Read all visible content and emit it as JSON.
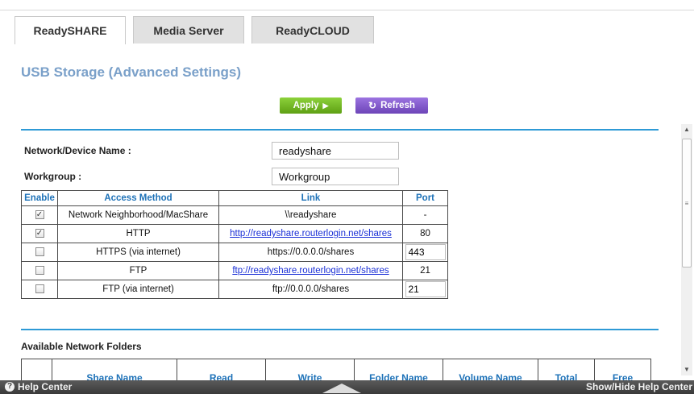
{
  "tabs": [
    {
      "label": "ReadySHARE",
      "active": true
    },
    {
      "label": "Media Server",
      "active": false
    },
    {
      "label": "ReadyCLOUD",
      "active": false
    }
  ],
  "page_title": "USB Storage (Advanced Settings)",
  "buttons": {
    "apply_label": "Apply",
    "apply_icon": "play-arrow-icon",
    "refresh_label": "Refresh",
    "refresh_icon": "refresh-icon"
  },
  "device": {
    "network_device_name_label": "Network/Device Name :",
    "network_device_name_value": "readyshare",
    "workgroup_label": "Workgroup :",
    "workgroup_value": "Workgroup"
  },
  "access_table": {
    "headers": [
      "Enable",
      "Access Method",
      "Link",
      "Port"
    ],
    "rows": [
      {
        "enabled": true,
        "method": "Network Neighborhood/MacShare",
        "link": "\\\\readyshare",
        "link_is_url": false,
        "port": "-",
        "port_editable": false
      },
      {
        "enabled": true,
        "method": "HTTP",
        "link": "http://readyshare.routerlogin.net/shares",
        "link_is_url": true,
        "port": "80",
        "port_editable": false
      },
      {
        "enabled": false,
        "method": "HTTPS (via internet)",
        "link": "https://0.0.0.0/shares",
        "link_is_url": false,
        "port": "443",
        "port_editable": true
      },
      {
        "enabled": false,
        "method": "FTP",
        "link": "ftp://readyshare.routerlogin.net/shares",
        "link_is_url": true,
        "port": "21",
        "port_editable": false
      },
      {
        "enabled": false,
        "method": "FTP (via internet)",
        "link": "ftp://0.0.0.0/shares",
        "link_is_url": false,
        "port": "21",
        "port_editable": true
      }
    ]
  },
  "folders": {
    "title": "Available Network Folders",
    "headers": [
      "",
      "Share Name",
      "Read",
      "Write",
      "Folder Name",
      "Volume Name",
      "Total",
      "Free"
    ]
  },
  "footer": {
    "help_center_label": "Help Center",
    "help_icon": "question-circle-icon",
    "show_hide_label": "Show/Hide Help Center"
  },
  "colors": {
    "accent_blue": "#2e9ad6",
    "title_blue": "#7aa0c9",
    "apply_green": "#6fb822",
    "refresh_purple": "#7d55c8"
  }
}
